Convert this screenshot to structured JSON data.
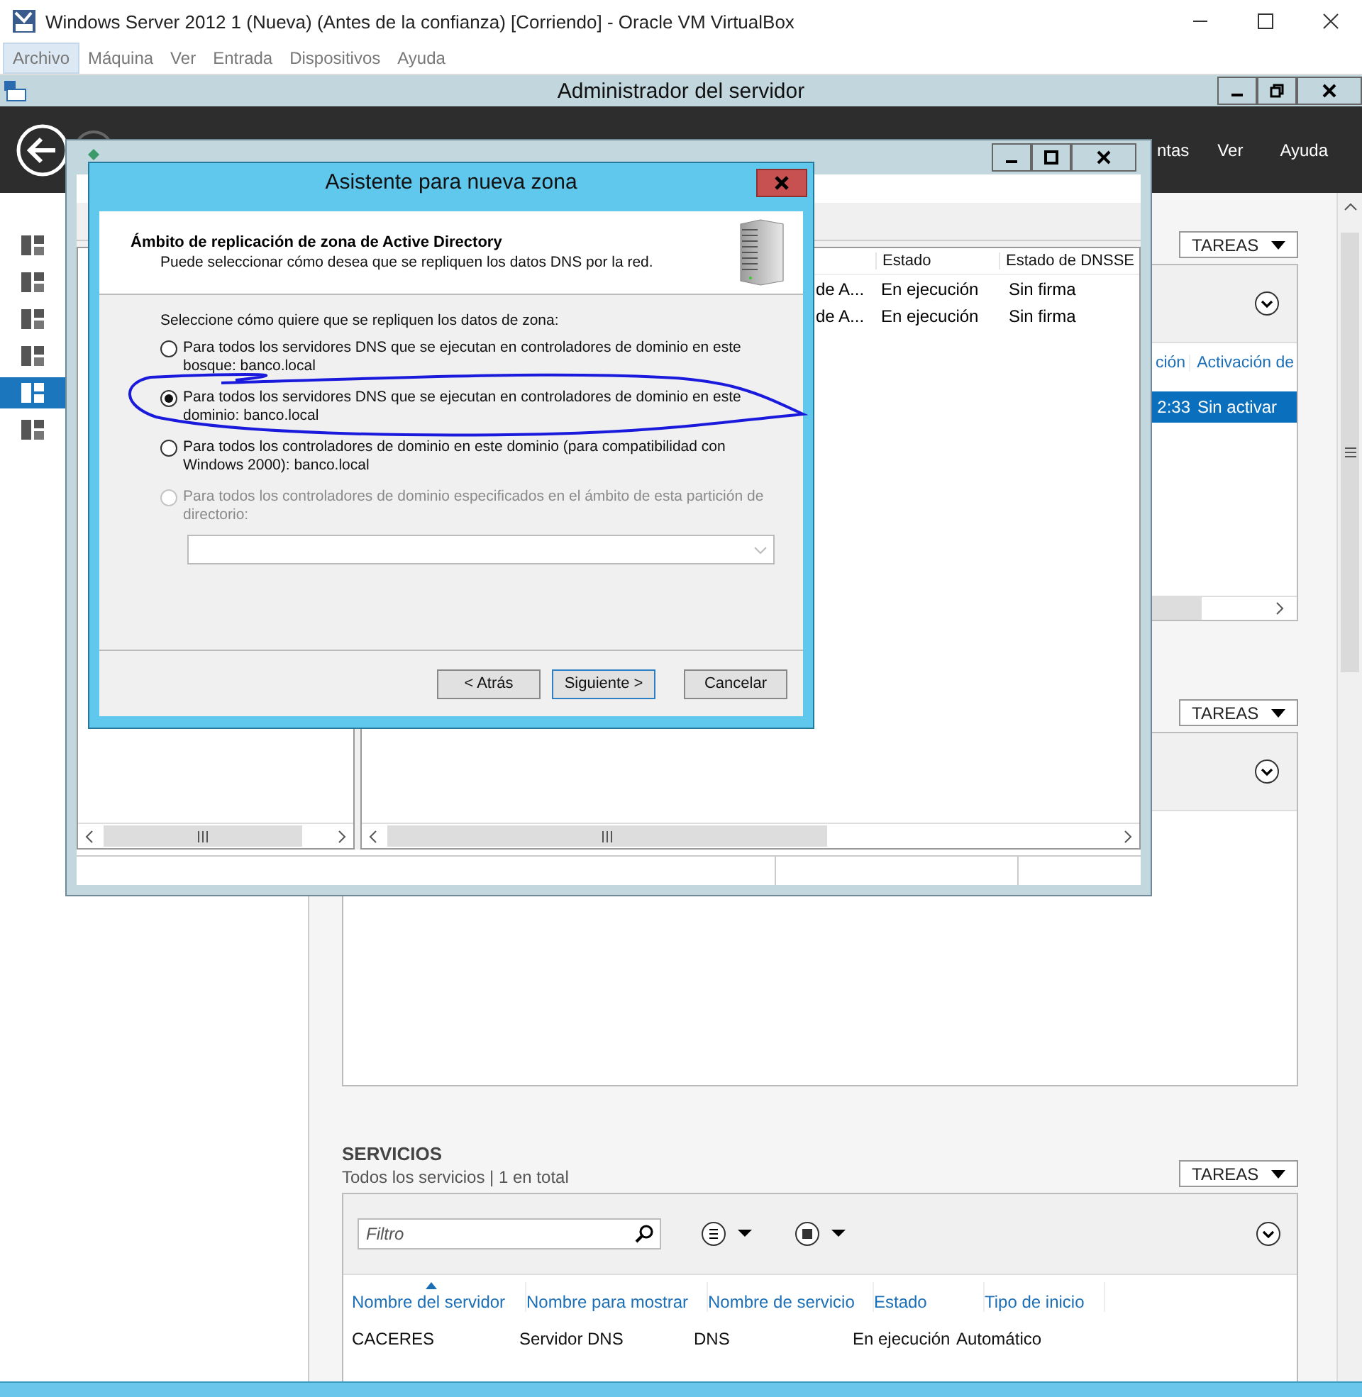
{
  "vm_window": {
    "title": "Windows Server 2012 1 (Nueva) (Antes de la confianza) [Corriendo] - Oracle VM VirtualBox",
    "menu": [
      {
        "label": "Archivo",
        "selected": true
      },
      {
        "label": "Máquina",
        "selected": false
      },
      {
        "label": "Ver",
        "selected": false
      },
      {
        "label": "Entrada",
        "selected": false
      },
      {
        "label": "Dispositivos",
        "selected": false
      },
      {
        "label": "Ayuda",
        "selected": false
      }
    ]
  },
  "server_manager": {
    "title": "Administrador del servidor",
    "header_menu": [
      "ntas",
      "Ver",
      "Ayuda"
    ],
    "sidebar": [
      {
        "selected": false
      },
      {
        "selected": false
      },
      {
        "selected": false
      },
      {
        "selected": false
      },
      {
        "selected": true
      },
      {
        "selected": false
      }
    ],
    "panels": [
      {
        "tasks": "TAREAS",
        "columns": [
          "ción",
          "Activación de"
        ],
        "rows": [
          {
            "cells": [
              "2:33",
              "Sin activar"
            ],
            "selected": true
          }
        ]
      },
      {
        "tasks": "TAREAS"
      }
    ],
    "services": {
      "title": "SERVICIOS",
      "subtitle": "Todos los servicios | 1 en total",
      "tasks": "TAREAS",
      "filter": {
        "placeholder": "Filtro"
      },
      "columns": [
        {
          "label": "Nombre del servidor",
          "sorted": true
        },
        {
          "label": "Nombre para mostrar",
          "sorted": false
        },
        {
          "label": "Nombre de servicio",
          "sorted": false
        },
        {
          "label": "Estado",
          "sorted": false
        },
        {
          "label": "Tipo de inicio",
          "sorted": false
        }
      ],
      "rows": [
        [
          "CACERES",
          "Servidor DNS",
          "DNS",
          "En ejecución",
          "Automático"
        ]
      ]
    }
  },
  "dns_window": {
    "columns": {
      "status": "Estado",
      "dnssec": "Estado de DNSSE"
    },
    "rows": [
      {
        "name": "de A...",
        "status": "En ejecución",
        "dnssec": "Sin firma"
      },
      {
        "name": "de A...",
        "status": "En ejecución",
        "dnssec": "Sin firma"
      }
    ]
  },
  "wizard": {
    "title": "Asistente para nueva zona",
    "heading": "Ámbito de replicación de zona de Active Directory",
    "description": "Puede seleccionar cómo desea que se repliquen los datos DNS por la red.",
    "prompt": "Seleccione cómo quiere que se repliquen los datos de zona:",
    "options": [
      {
        "label": "Para todos los servidores DNS que se ejecutan en controladores de dominio en este bosque: banco.local",
        "selected": false,
        "disabled": false
      },
      {
        "label": "Para todos los servidores DNS que se ejecutan en controladores de dominio en este dominio: banco.local",
        "selected": true,
        "disabled": false
      },
      {
        "label": "Para todos los controladores de dominio en este dominio (para compatibilidad con Windows 2000): banco.local",
        "selected": false,
        "disabled": false
      },
      {
        "label": "Para todos los controladores de dominio especificados en el ámbito de esta partición de directorio:",
        "selected": false,
        "disabled": true
      }
    ],
    "buttons": [
      {
        "label": "< Atrás",
        "default": false
      },
      {
        "label": "Siguiente >",
        "default": true
      },
      {
        "label": "Cancelar",
        "default": false
      }
    ]
  }
}
